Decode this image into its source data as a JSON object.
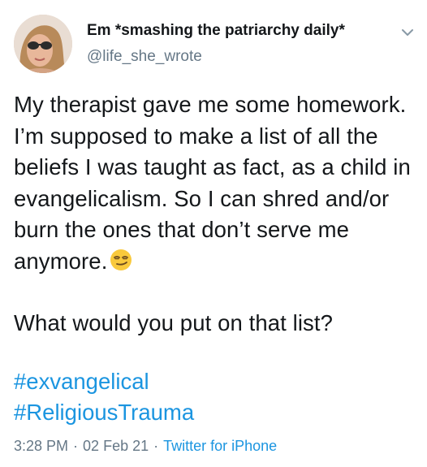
{
  "tweet": {
    "author": {
      "display_name": "Em *smashing the patriarchy daily*",
      "handle": "@life_she_wrote"
    },
    "body": {
      "paragraph1": "My therapist gave me some homework. I’m supposed to make a list of all the beliefs I was taught as fact, as a child in evangelicalism. So I can shred and/or burn the ones that don’t serve me anymore.",
      "paragraph1_emoji": "smirking-face",
      "paragraph2": "What would you put on that list?"
    },
    "hashtags": [
      "#exvangelical",
      "#ReligiousTrauma"
    ],
    "meta": {
      "time": "3:28 PM",
      "separator": "·",
      "date": "02 Feb 21",
      "source": "Twitter for iPhone"
    },
    "colors": {
      "text": "#14171a",
      "secondary": "#657786",
      "link": "#1b95e0"
    }
  }
}
